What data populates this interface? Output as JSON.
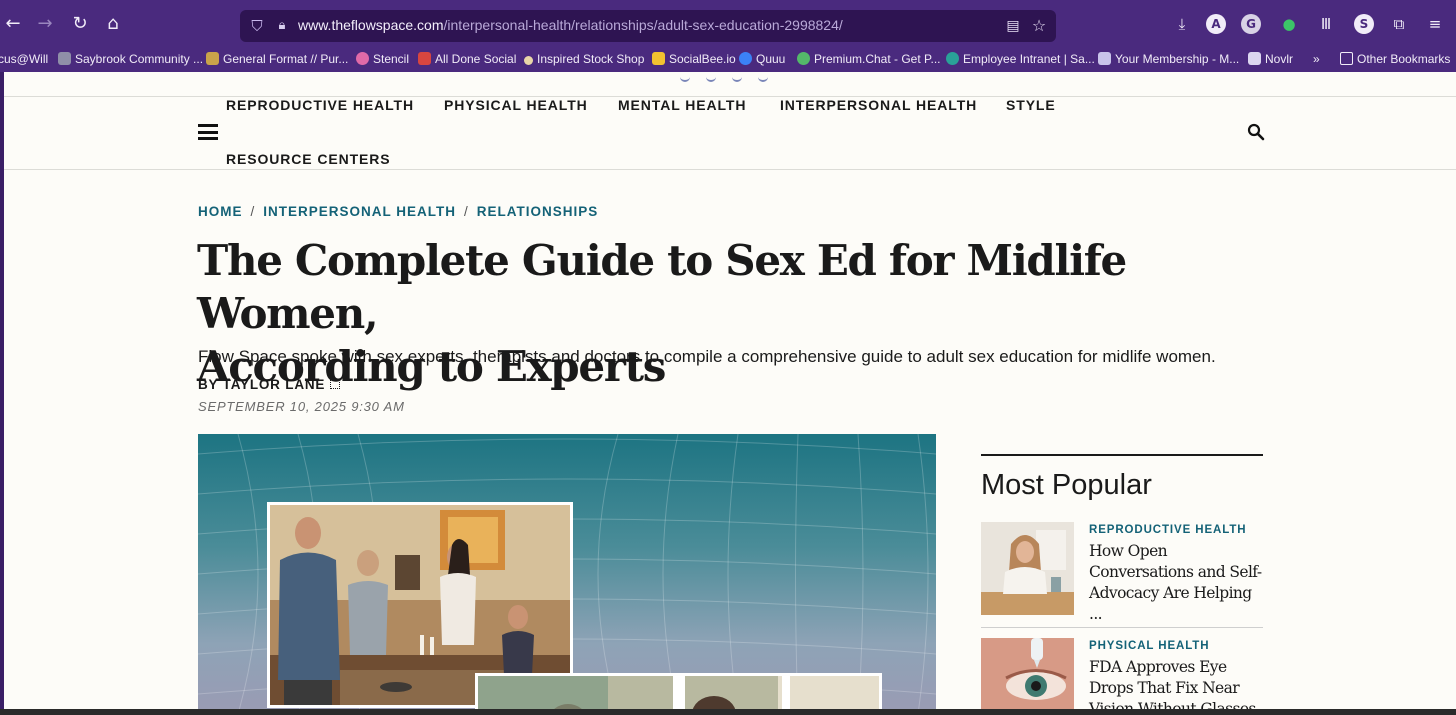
{
  "browser": {
    "url_host": "www.theflowspace.com",
    "url_path": "/interpersonal-health/relationships/adult-sex-education-2998824/",
    "bookmarks": [
      {
        "label": "cus@Will",
        "color": ""
      },
      {
        "label": "Saybrook Community ...",
        "color": "#8f8fa8"
      },
      {
        "label": "General Format // Pur...",
        "color": "#c9a34a"
      },
      {
        "label": "Stencil",
        "color": "#e06aa8"
      },
      {
        "label": "All Done Social",
        "color": "#d8463f"
      },
      {
        "label": "Inspired Stock Shop",
        "color": "#e8d6a8"
      },
      {
        "label": "SocialBee.io",
        "color": "#f2c230"
      },
      {
        "label": "Quuu",
        "color": "#3b82f6"
      },
      {
        "label": "Premium.Chat - Get P...",
        "color": "#54b86a"
      },
      {
        "label": "Employee Intranet | Sa...",
        "color": "#2aa198"
      },
      {
        "label": "Your Membership - M...",
        "color": "#c9c4ea"
      },
      {
        "label": "Novlr",
        "color": "#dcd6f0"
      },
      {
        "label": "Other Bookmarks",
        "color": ""
      }
    ]
  },
  "nav": {
    "items": [
      "REPRODUCTIVE HEALTH",
      "PHYSICAL HEALTH",
      "MENTAL HEALTH",
      "INTERPERSONAL HEALTH",
      "STYLE",
      "RESOURCE CENTERS"
    ]
  },
  "breadcrumb": [
    "HOME",
    "INTERPERSONAL HEALTH",
    "RELATIONSHIPS"
  ],
  "article": {
    "title_line1": "The Complete Guide to Sex Ed for Midlife Women,",
    "title_line2": "According to Experts",
    "dek": "Flow Space spoke with sex experts, therapists and doctors to compile a comprehensive guide to adult sex education for midlife women.",
    "byline": "BY TAYLOR LANE",
    "date": "SEPTEMBER 10, 2025 9:30 AM"
  },
  "sidebar": {
    "title": "Most Popular",
    "cards": [
      {
        "category": "REPRODUCTIVE HEALTH",
        "title": "How Open Conversations and Self-Advocacy Are Helping ..."
      },
      {
        "category": "PHYSICAL HEALTH",
        "title": "FDA Approves Eye Drops That Fix Near Vision Without Glasses"
      }
    ]
  },
  "colors": {
    "browser_chrome": "#4a2a7e",
    "accent_teal": "#146277",
    "page_background": "#fdfcf8"
  }
}
